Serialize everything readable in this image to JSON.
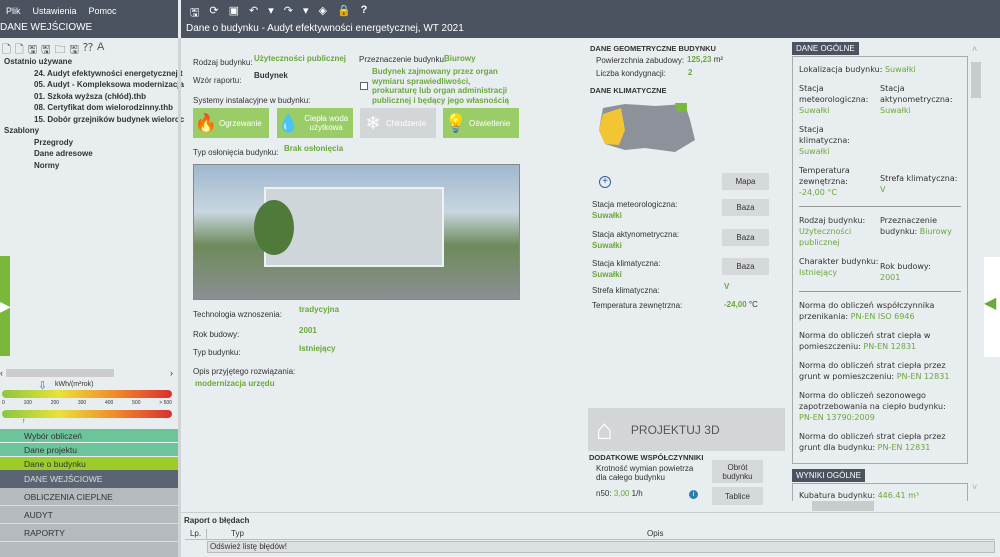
{
  "menu": {
    "items": [
      "Plik",
      "Ustawienia",
      "Pomoc"
    ]
  },
  "toolbar": {
    "icons": [
      "save-icon",
      "refresh-icon",
      "preview-icon",
      "undo-icon",
      "undo-dropdown-icon",
      "redo-icon",
      "redo-dropdown-icon",
      "layers-icon",
      "lock-icon",
      "help-icon"
    ],
    "help": "?"
  },
  "left": {
    "title": "DANE WEJŚCIOWE",
    "tree": {
      "recent_label": "Ostatnio używane",
      "recent": [
        "24. Audyt efektywności energetycznej.t",
        "05. Audyt - Kompleksowa modernizacja",
        "01. Szkoła wyższa (chłód).thb",
        "08. Certyfikat dom wielorodzinny.thb",
        "15. Dobór grzejników budynek wieloroc"
      ],
      "templates_label": "Szablony",
      "templates": [
        "Przegrody",
        "Dane adresowe",
        "Normy"
      ]
    },
    "scale": {
      "unit": "kWh/(m²rok)",
      "ticks": [
        "0",
        "100",
        "200",
        "300",
        "400",
        "500",
        "> 500"
      ]
    },
    "steps": [
      "Wybór obliczeń",
      "Dane projektu",
      "Dane o budynku"
    ],
    "sections": [
      "DANE WEJŚCIOWE",
      "OBLICZENIA CIEPLNE",
      "AUDYT",
      "RAPORTY"
    ]
  },
  "main": {
    "title": "Dane o budynku - Audyt efektywności energetycznej, WT 2021",
    "rodzaj_label": "Rodzaj budynku:",
    "rodzaj": "Użyteczności publicznej",
    "wzor_label": "Wzór raportu:",
    "wzor": "Budynek",
    "przezn_label": "Przeznaczenie budynku:",
    "przezn": "Biurowy",
    "checkbox": "Budynek zajmowany przez organ wymiaru sprawiedliwości, prokuraturę lub organ administracji publicznej i będący jego własnością",
    "systemy_label": "Systemy instalacyjne w budynku:",
    "systems": [
      {
        "label": "Ogrzewanie",
        "icon": "flame-icon",
        "active": true
      },
      {
        "label": "Ciepła woda użytkowa",
        "icon": "drop-icon",
        "active": true
      },
      {
        "label": "Chłodzenie",
        "icon": "snowflake-icon",
        "active": false
      },
      {
        "label": "Oświetlenie",
        "icon": "bulb-icon",
        "active": true
      }
    ],
    "oslon_label": "Typ osłonięcia budynku:",
    "oslon": "Brak osłonięcia",
    "tech_label": "Technologia wznoszenia:",
    "tech": "tradycyjna",
    "rok_label": "Rok budowy:",
    "rok": "2001",
    "typ_label": "Typ budynku:",
    "typ": "Istniejący",
    "opis_label": "Opis przyjętego rozwiązania:",
    "opis": "modernizacja urzędu"
  },
  "geo": {
    "title": "DANE GEOMETRYCZNE BUDYNKU",
    "pow_label": "Powierzchnia zabudowy:",
    "pow": "125,23",
    "pow_unit": "m²",
    "kond_label": "Liczba kondygnacji:",
    "kond": "2"
  },
  "klim": {
    "title": "DANE KLIMATYCZNE",
    "mapa": "Mapa",
    "baza": "Baza",
    "met_label": "Stacja meteorologiczna:",
    "met": "Suwałki",
    "akt_label": "Stacja aktynometryczna:",
    "akt": "Suwałki",
    "kli_label": "Stacja klimatyczna:",
    "kli": "Suwałki",
    "strefa_label": "Strefa klimatyczna:",
    "strefa": "V",
    "temp_label": "Temperatura zewnętrzna:",
    "temp": "-24,00",
    "temp_unit": "°C"
  },
  "projektuj": "PROJEKTUJ 3D",
  "dodatkowe": {
    "title": "DODATKOWE WSPÓŁCZYNNIKI",
    "krot": "Krotność wymian powietrza dla całego budynku",
    "n50_label": "n50:",
    "n50": "3,00",
    "n50_unit": "1/h",
    "obrot": "Obrót budynku",
    "tablice": "Tablice"
  },
  "ogolne": {
    "title": "DANE OGÓLNE",
    "lok_label": "Lokalizacja budynku:",
    "lok": "Suwałki",
    "met_label": "Stacja meteorologiczna:",
    "met": "Suwałki",
    "akt_label": "Stacja aktynometryczna:",
    "akt": "Suwałki",
    "kli_label": "Stacja klimatyczna:",
    "kli": "Suwałki",
    "temp_label": "Temperatura zewnętrzna:",
    "temp": "-24,00 °C",
    "strefa_label": "Strefa klimatyczna:",
    "strefa": "V",
    "rodzaj_label": "Rodzaj budynku:",
    "rodzaj": "Użyteczności publicznej",
    "przezn_label": "Przeznaczenie budynku:",
    "przezn": "Biurowy",
    "char_label": "Charakter budynku:",
    "char": "Istniejący",
    "rok_label": "Rok budowy:",
    "rok": "2001",
    "normy": [
      {
        "label": "Norma do obliczeń współczynnika przenikania:",
        "value": "PN-EN ISO 6946"
      },
      {
        "label": "Norma do obliczeń strat ciepła w pomieszczeniu:",
        "value": "PN-EN 12831"
      },
      {
        "label": "Norma do obliczeń strat ciepła przez grunt w pomieszczeniu:",
        "value": "PN-EN 12831"
      },
      {
        "label": "Norma do obliczeń sezonowego zapotrzebowania na ciepło budynku:",
        "value": "PN-EN 13790:2009"
      },
      {
        "label": "Norma do obliczeń strat ciepła przez grunt dla budynku:",
        "value": "PN-EN 12831"
      }
    ]
  },
  "wyniki": {
    "title": "WYNIKI OGÓLNE",
    "kub_label": "Kubatura budynku:",
    "kub": "446.41 m³"
  },
  "errors": {
    "title": "Raport o błędach",
    "cols": [
      "Lp.",
      "Typ",
      "Opis"
    ],
    "msg": "Odśwież listę błędów!"
  },
  "colors": {
    "accent": "#6aa83c",
    "dark": "#4b5360",
    "system_active": "#9acd68"
  }
}
